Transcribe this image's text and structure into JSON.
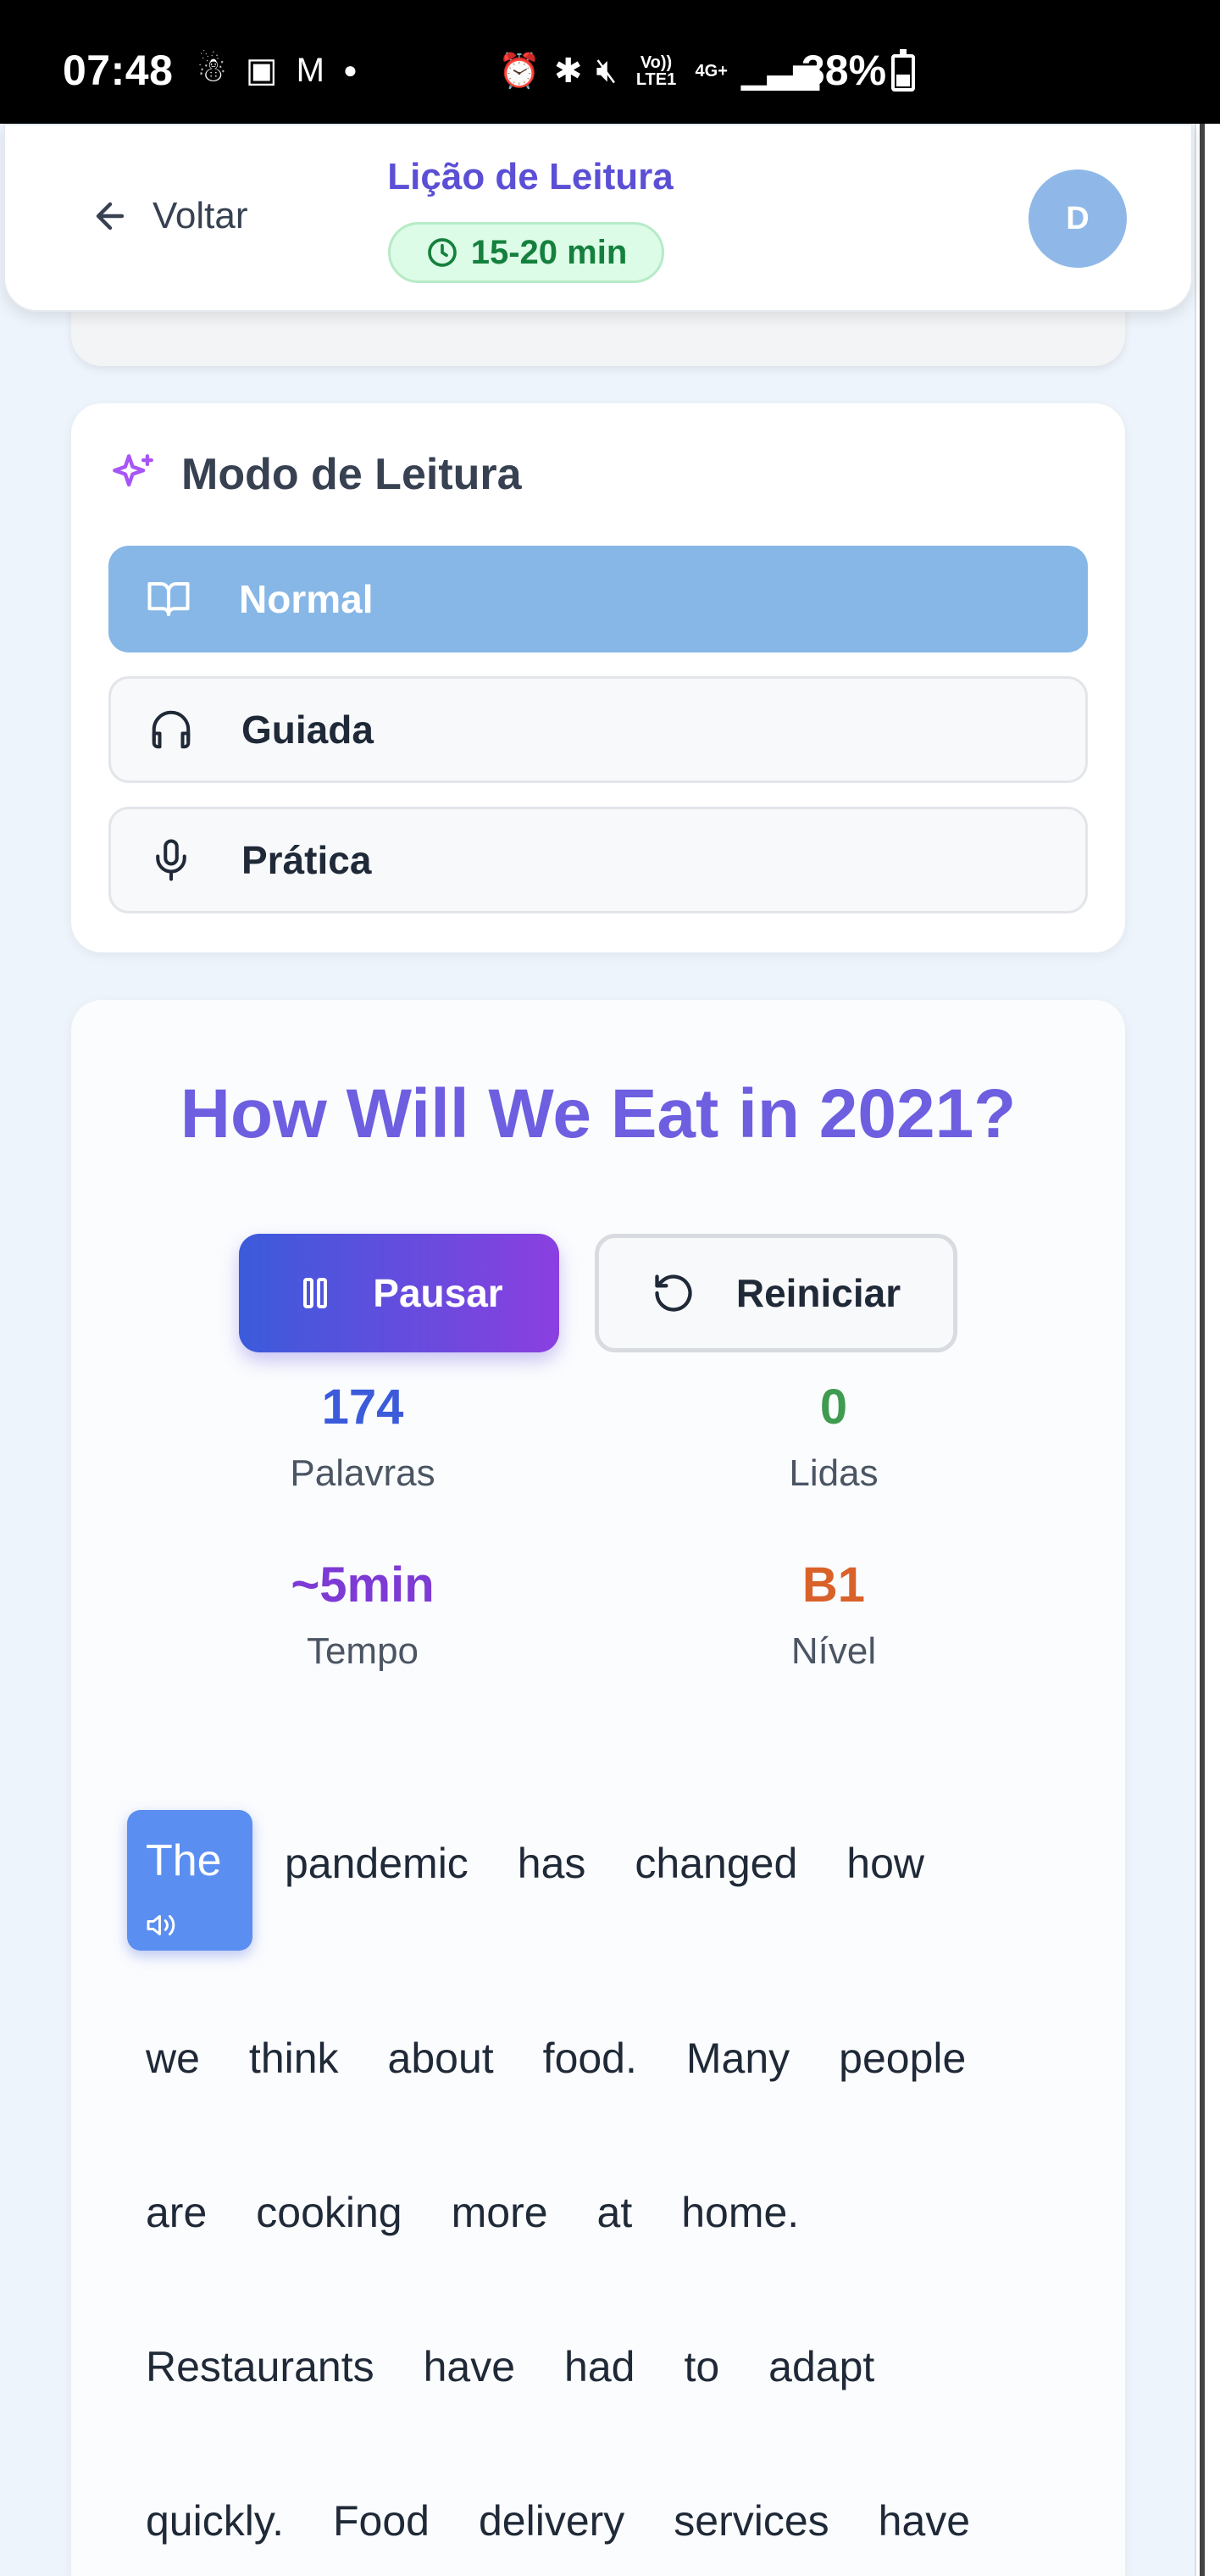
{
  "status_bar": {
    "time": "07:48",
    "battery": "38%",
    "network_tag_1": "Vo)) LTE1",
    "network_tag_2": "4G+"
  },
  "header": {
    "back_label": "Voltar",
    "title": "Lição de Leitura",
    "duration": "15-20 min",
    "avatar_initial": "D"
  },
  "reading_mode": {
    "title": "Modo de Leitura",
    "options": [
      {
        "label": "Normal",
        "icon": "book-open-icon",
        "active": true
      },
      {
        "label": "Guiada",
        "icon": "headphones-icon",
        "active": false
      },
      {
        "label": "Prática",
        "icon": "microphone-icon",
        "active": false
      }
    ]
  },
  "lesson": {
    "title": "How Will We Eat in 2021?",
    "pause_label": "Pausar",
    "restart_label": "Reiniciar",
    "stats": {
      "words_value": "174",
      "words_label": "Palavras",
      "read_value": "0",
      "read_label": "Lidas",
      "time_value": "~5min",
      "time_label": "Tempo",
      "level_value": "B1",
      "level_label": "Nível"
    },
    "lines": [
      [
        "The",
        "pandemic",
        "has",
        "changed",
        "how"
      ],
      [
        "we",
        "think",
        "about",
        "food.",
        "Many",
        "people"
      ],
      [
        "are",
        "cooking",
        "more",
        "at",
        "home."
      ],
      [
        "Restaurants",
        "have",
        "had",
        "to",
        "adapt"
      ],
      [
        "quickly.",
        "Food",
        "delivery",
        "services",
        "have"
      ]
    ]
  },
  "colors": {
    "accent_purple": "#5b4fd6",
    "stat_blue": "#3b5bdb",
    "stat_green": "#3f9b50",
    "stat_purple": "#7e3ad4",
    "stat_orange": "#d9622b"
  }
}
